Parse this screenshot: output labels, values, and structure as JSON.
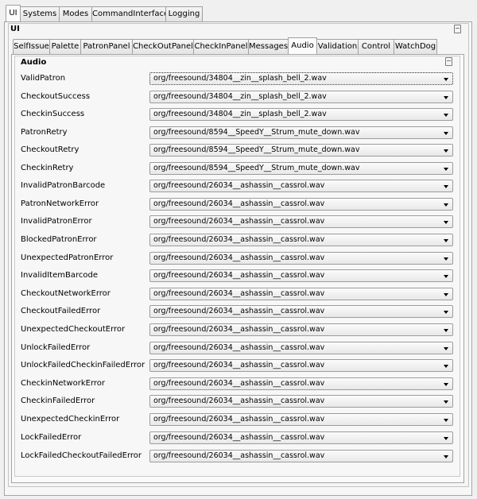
{
  "top_tabs": [
    "UI",
    "Systems",
    "Modes",
    "CommandInterface",
    "Logging"
  ],
  "top_active": "UI",
  "ui_group_title": "UI",
  "sub_tabs": [
    "SelfIssue",
    "Palette",
    "PatronPanel",
    "CheckOutPanel",
    "CheckInPanel",
    "Messages",
    "Audio",
    "Validation",
    "Control",
    "WatchDog"
  ],
  "sub_active": "Audio",
  "audio_group_title": "Audio",
  "rows": [
    {
      "label": "ValidPatron",
      "value": "org/freesound/34804__zin__splash_bell_2.wav"
    },
    {
      "label": "CheckoutSuccess",
      "value": "org/freesound/34804__zin__splash_bell_2.wav"
    },
    {
      "label": "CheckinSuccess",
      "value": "org/freesound/34804__zin__splash_bell_2.wav"
    },
    {
      "label": "PatronRetry",
      "value": "org/freesound/8594__SpeedY__Strum_mute_down.wav"
    },
    {
      "label": "CheckoutRetry",
      "value": "org/freesound/8594__SpeedY__Strum_mute_down.wav"
    },
    {
      "label": "CheckinRetry",
      "value": "org/freesound/8594__SpeedY__Strum_mute_down.wav"
    },
    {
      "label": "InvalidPatronBarcode",
      "value": "org/freesound/26034__ashassin__cassrol.wav"
    },
    {
      "label": "PatronNetworkError",
      "value": "org/freesound/26034__ashassin__cassrol.wav"
    },
    {
      "label": "InvalidPatronError",
      "value": "org/freesound/26034__ashassin__cassrol.wav"
    },
    {
      "label": "BlockedPatronError",
      "value": "org/freesound/26034__ashassin__cassrol.wav"
    },
    {
      "label": "UnexpectedPatronError",
      "value": "org/freesound/26034__ashassin__cassrol.wav"
    },
    {
      "label": "InvalidItemBarcode",
      "value": "org/freesound/26034__ashassin__cassrol.wav"
    },
    {
      "label": "CheckoutNetworkError",
      "value": "org/freesound/26034__ashassin__cassrol.wav"
    },
    {
      "label": "CheckoutFailedError",
      "value": "org/freesound/26034__ashassin__cassrol.wav"
    },
    {
      "label": "UnexpectedCheckoutError",
      "value": "org/freesound/26034__ashassin__cassrol.wav"
    },
    {
      "label": "UnlockFailedError",
      "value": "org/freesound/26034__ashassin__cassrol.wav"
    },
    {
      "label": "UnlockFailedCheckinFailedError",
      "value": "org/freesound/26034__ashassin__cassrol.wav"
    },
    {
      "label": "CheckinNetworkError",
      "value": "org/freesound/26034__ashassin__cassrol.wav"
    },
    {
      "label": "CheckinFailedError",
      "value": "org/freesound/26034__ashassin__cassrol.wav"
    },
    {
      "label": "UnexpectedCheckinError",
      "value": "org/freesound/26034__ashassin__cassrol.wav"
    },
    {
      "label": "LockFailedError",
      "value": "org/freesound/26034__ashassin__cassrol.wav"
    },
    {
      "label": "LockFailedCheckoutFailedError",
      "value": "org/freesound/26034__ashassin__cassrol.wav"
    }
  ]
}
